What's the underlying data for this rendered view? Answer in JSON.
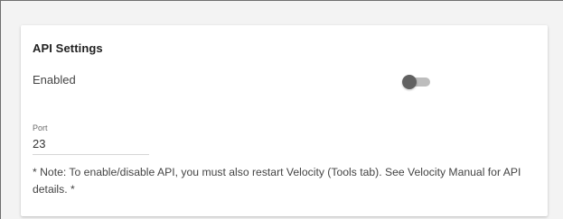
{
  "card": {
    "title": "API Settings"
  },
  "enabled": {
    "label": "Enabled",
    "state": "off",
    "track_color": "#bdbdbd",
    "thumb_color": "#616161"
  },
  "port": {
    "label": "Port",
    "value": "23"
  },
  "note": {
    "text": "* Note: To enable/disable API, you must also restart Velocity (Tools tab). See Velocity Manual for API details. *"
  }
}
